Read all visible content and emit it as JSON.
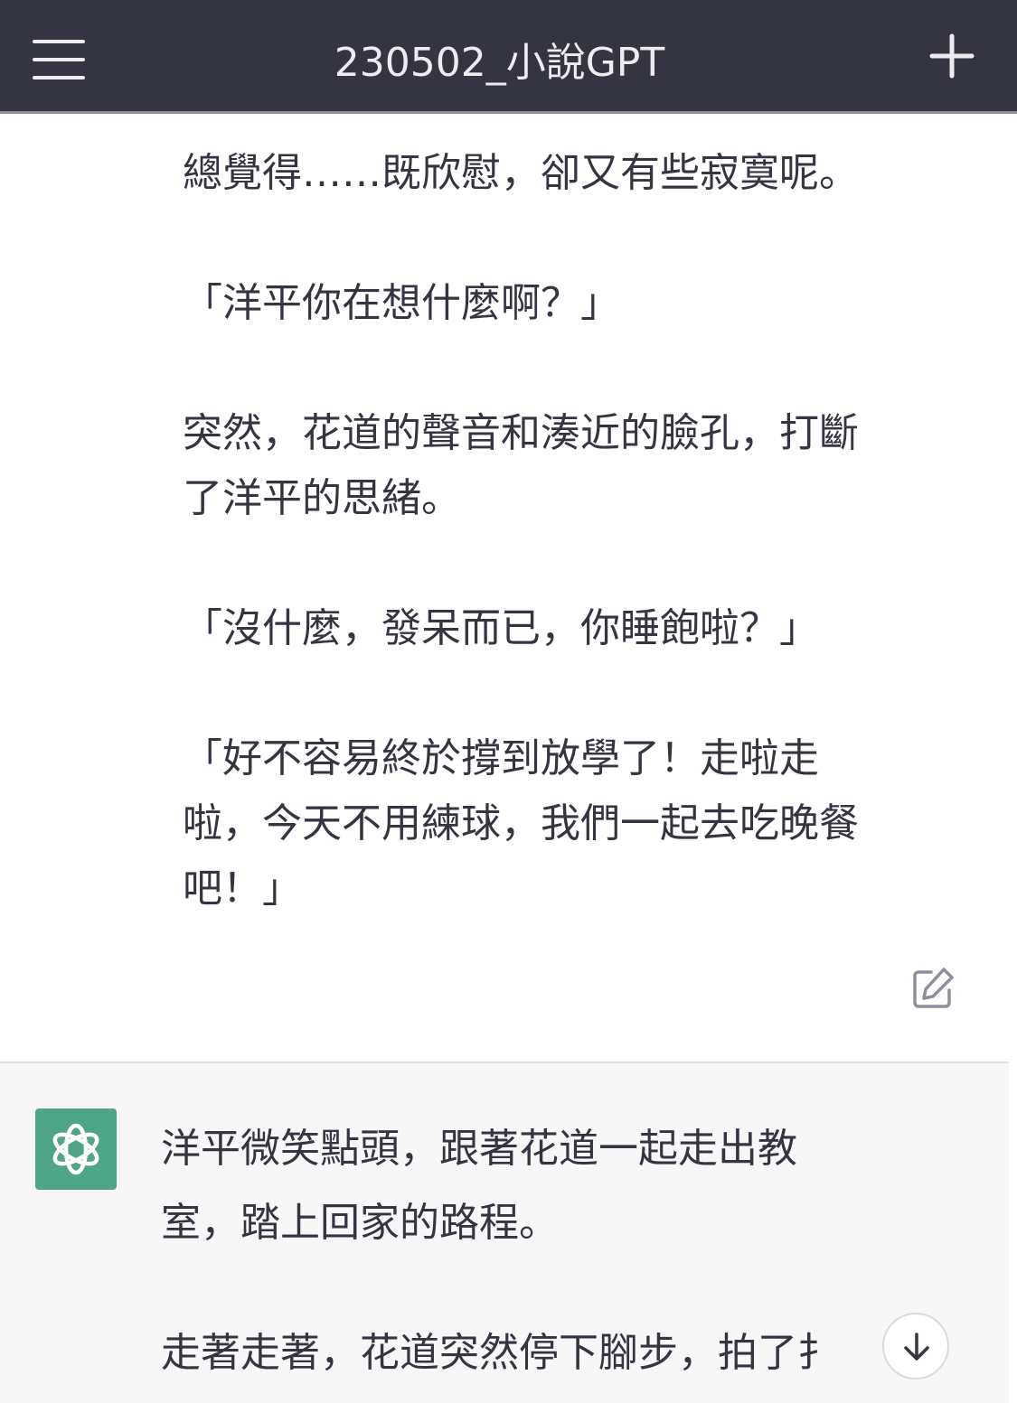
{
  "header": {
    "title": "230502_小說GPT",
    "menu_icon": "hamburger-menu-icon",
    "new_chat_icon": "plus-icon"
  },
  "conversation": {
    "user_message": {
      "paragraphs": [
        "總覺得……既欣慰，卻又有些寂寞呢。",
        "「洋平你在想什麼啊？」",
        [
          "突然，花道的聲音和湊近的臉孔，打斷",
          "了洋平的思緒。"
        ],
        "「沒什麼，發呆而已，你睡飽啦？」",
        [
          "「好不容易終於撐到放學了！走啦走",
          "啦，今天不用練球，我們一起去吃晚餐",
          "吧！」"
        ]
      ],
      "edit_icon": "edit-icon"
    },
    "assistant_message": {
      "avatar_icon": "openai-logo-icon",
      "paragraphs": [
        [
          "洋平微笑點頭，跟著花道一起走出教",
          "室，踏上回家的路程。"
        ],
        [
          "走著走著，花道突然停下腳步，拍了扌"
        ]
      ]
    }
  },
  "scroll_down_icon": "arrow-down-icon",
  "colors": {
    "header_bg": "#343541",
    "assistant_bg": "#f7f7f8",
    "avatar_bg": "#4fa587",
    "text": "#343541"
  }
}
